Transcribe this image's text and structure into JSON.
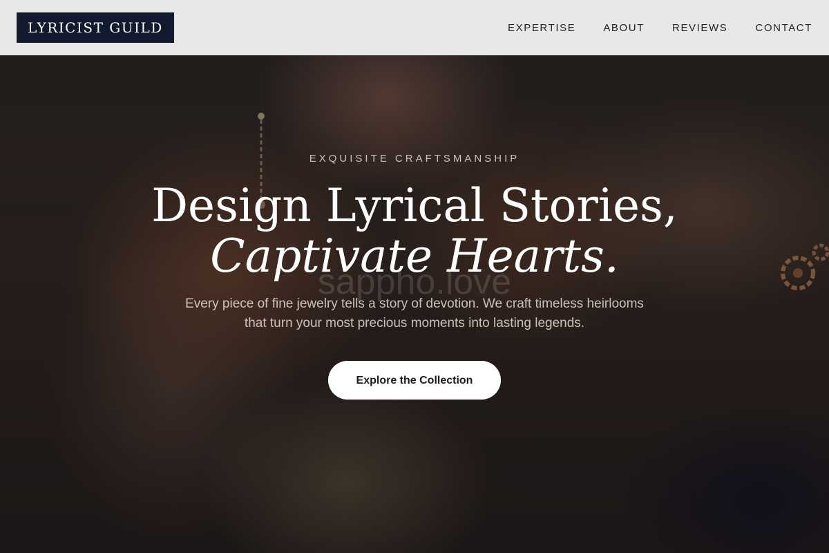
{
  "navbar": {
    "logo": "LYRICIST GUILD",
    "links": [
      {
        "label": "EXPERTISE"
      },
      {
        "label": "ABOUT"
      },
      {
        "label": "REVIEWS"
      },
      {
        "label": "CONTACT"
      }
    ]
  },
  "hero": {
    "eyebrow": "EXQUISITE CRAFTSMANSHIP",
    "headline_line1": "Design Lyrical Stories,",
    "headline_line2": "Captivate Hearts.",
    "watermark": "sappho.love",
    "subtext": "Every piece of fine jewelry tells a story of devotion. We craft timeless heirlooms that turn your most precious moments into lasting legends.",
    "cta_label": "Explore the Collection"
  },
  "colors": {
    "logo_bg": "#111a2e",
    "navbar_bg": "#eeeeee",
    "cta_bg": "#ffffff"
  }
}
